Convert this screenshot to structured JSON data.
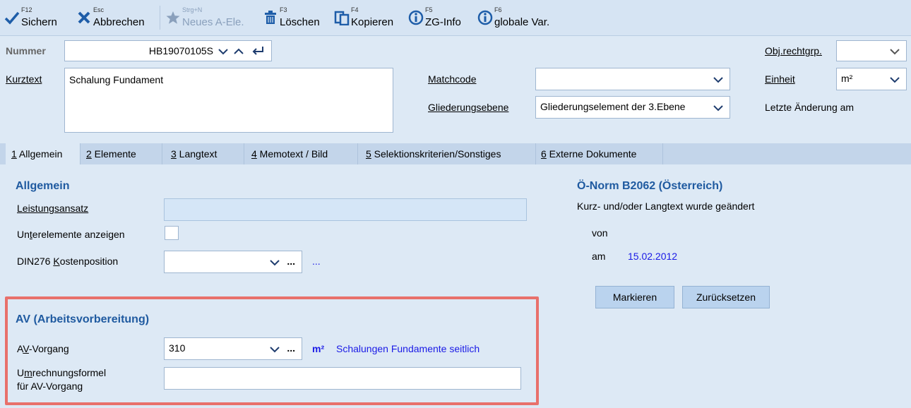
{
  "toolbar": {
    "buttons": [
      {
        "key": "F12",
        "label": "Sichern",
        "icon": "checkmark-icon",
        "enabled": true
      },
      {
        "key": "Esc",
        "label": "Abbrechen",
        "icon": "close-x-icon",
        "enabled": true
      },
      {
        "key": "Strg+N",
        "label": "Neues A-Ele.",
        "icon": "star-icon",
        "enabled": false
      },
      {
        "key": "F3",
        "label": "Löschen",
        "icon": "trash-icon",
        "enabled": true
      },
      {
        "key": "F4",
        "label": "Kopieren",
        "icon": "copy-icon",
        "enabled": true
      },
      {
        "key": "F5",
        "label": "ZG-Info",
        "icon": "info-icon",
        "enabled": true
      },
      {
        "key": "F6",
        "label": "globale Var.",
        "icon": "info-icon",
        "enabled": true
      }
    ]
  },
  "header": {
    "nummer_label": "Nummer",
    "nummer_value": "HB19070105S",
    "kurztext_label": "Kurztext",
    "kurztext_value": "Schalung Fundament",
    "matchcode_label": "Matchcode",
    "matchcode_value": "",
    "gliederungsebene_label": "Gliederungsebene",
    "gliederungsebene_value": "Gliederungselement der 3.Ebene",
    "obj_rechtgrp_label": "Obj.rechtgrp.",
    "obj_rechtgrp_value": "",
    "einheit_label": "Einheit",
    "einheit_value": "m²",
    "letzte_aenderung_label": "Letzte Änderung am"
  },
  "tabs": [
    {
      "num": "1",
      "label": " Allgemein",
      "active": true
    },
    {
      "num": "2",
      "label": " Elemente",
      "active": false
    },
    {
      "num": "3",
      "label": " Langtext",
      "active": false
    },
    {
      "num": "4",
      "label": " Memotext / Bild",
      "active": false
    },
    {
      "num": "5",
      "label": " Selektionskriterien/Sonstiges",
      "active": false
    },
    {
      "num": "6",
      "label": " Externe Dokumente",
      "active": false
    }
  ],
  "allgemein": {
    "title": "Allgemein",
    "leistungsansatz_label": "Leistungsansatz",
    "leistungsansatz_value": "",
    "unterelemente_label": "Unterelemente anzeigen",
    "unterelemente_checked": false,
    "din276_label": "DIN276 Kostenposition",
    "din276_value": "",
    "din276_link": "..."
  },
  "av": {
    "title": "AV (Arbeitsvorbereitung)",
    "vorgang_label": "AV-Vorgang",
    "vorgang_value": "310",
    "vorgang_unit": "m²",
    "vorgang_desc": "Schalungen Fundamente seitlich",
    "formel_label_1": "Umrechnungsformel",
    "formel_label_2": "für AV-Vorgang",
    "formel_value": ""
  },
  "onorm": {
    "title": "Ö-Norm B2062 (Österreich)",
    "status": "Kurz- und/oder Langtext wurde geändert",
    "von_label": "von",
    "am_label": "am",
    "am_value": "15.02.2012",
    "markieren": "Markieren",
    "zuruecksetzen": "Zurücksetzen"
  },
  "colors": {
    "accent": "#1f5aa0",
    "highlight_border": "#e8706b",
    "link": "#1a1ae6",
    "background": "#dde9f5"
  }
}
